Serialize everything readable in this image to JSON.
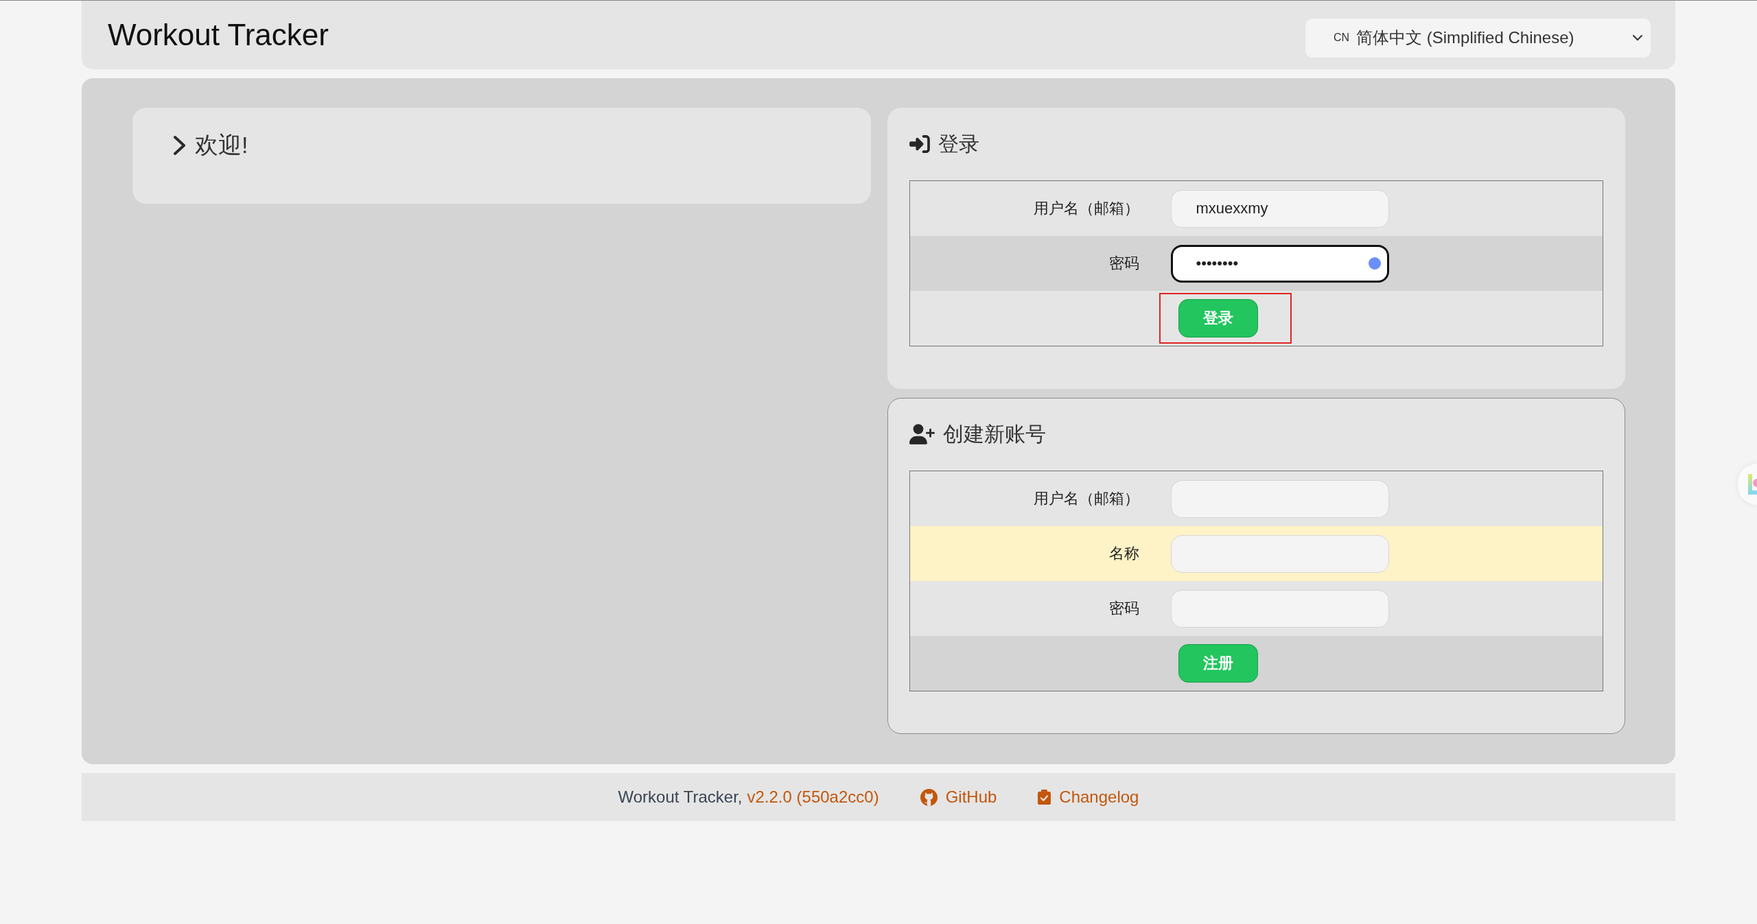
{
  "header": {
    "title": "Workout Tracker",
    "language": {
      "flag": "CN",
      "label": "简体中文 (Simplified Chinese)"
    }
  },
  "welcome": {
    "title": "欢迎!",
    "expanded": false
  },
  "login": {
    "title": "登录",
    "outlined": false,
    "fields": [
      {
        "label": "用户名（邮箱）",
        "value": "mxuexxmy",
        "focused": false,
        "hovered": false
      },
      {
        "label": "密码",
        "value": "••••••••",
        "focused": true,
        "hovered": false
      }
    ],
    "button": {
      "label": "登录",
      "highlighted": true
    }
  },
  "register": {
    "title": "创建新账号",
    "outlined": true,
    "fields": [
      {
        "label": "用户名（邮箱）",
        "focused": false,
        "hovered": false
      },
      {
        "label": "名称",
        "focused": false,
        "hovered": true
      },
      {
        "label": "密码",
        "focused": false,
        "hovered": false
      }
    ],
    "button": {
      "label": "注册",
      "highlighted": false
    }
  },
  "footer": {
    "app": "Workout Tracker,",
    "version": "v2.2.0 (550a2cc0)",
    "links": [
      {
        "label": "GitHub",
        "kind": "github"
      },
      {
        "label": "Changelog",
        "kind": "changelog"
      }
    ]
  }
}
